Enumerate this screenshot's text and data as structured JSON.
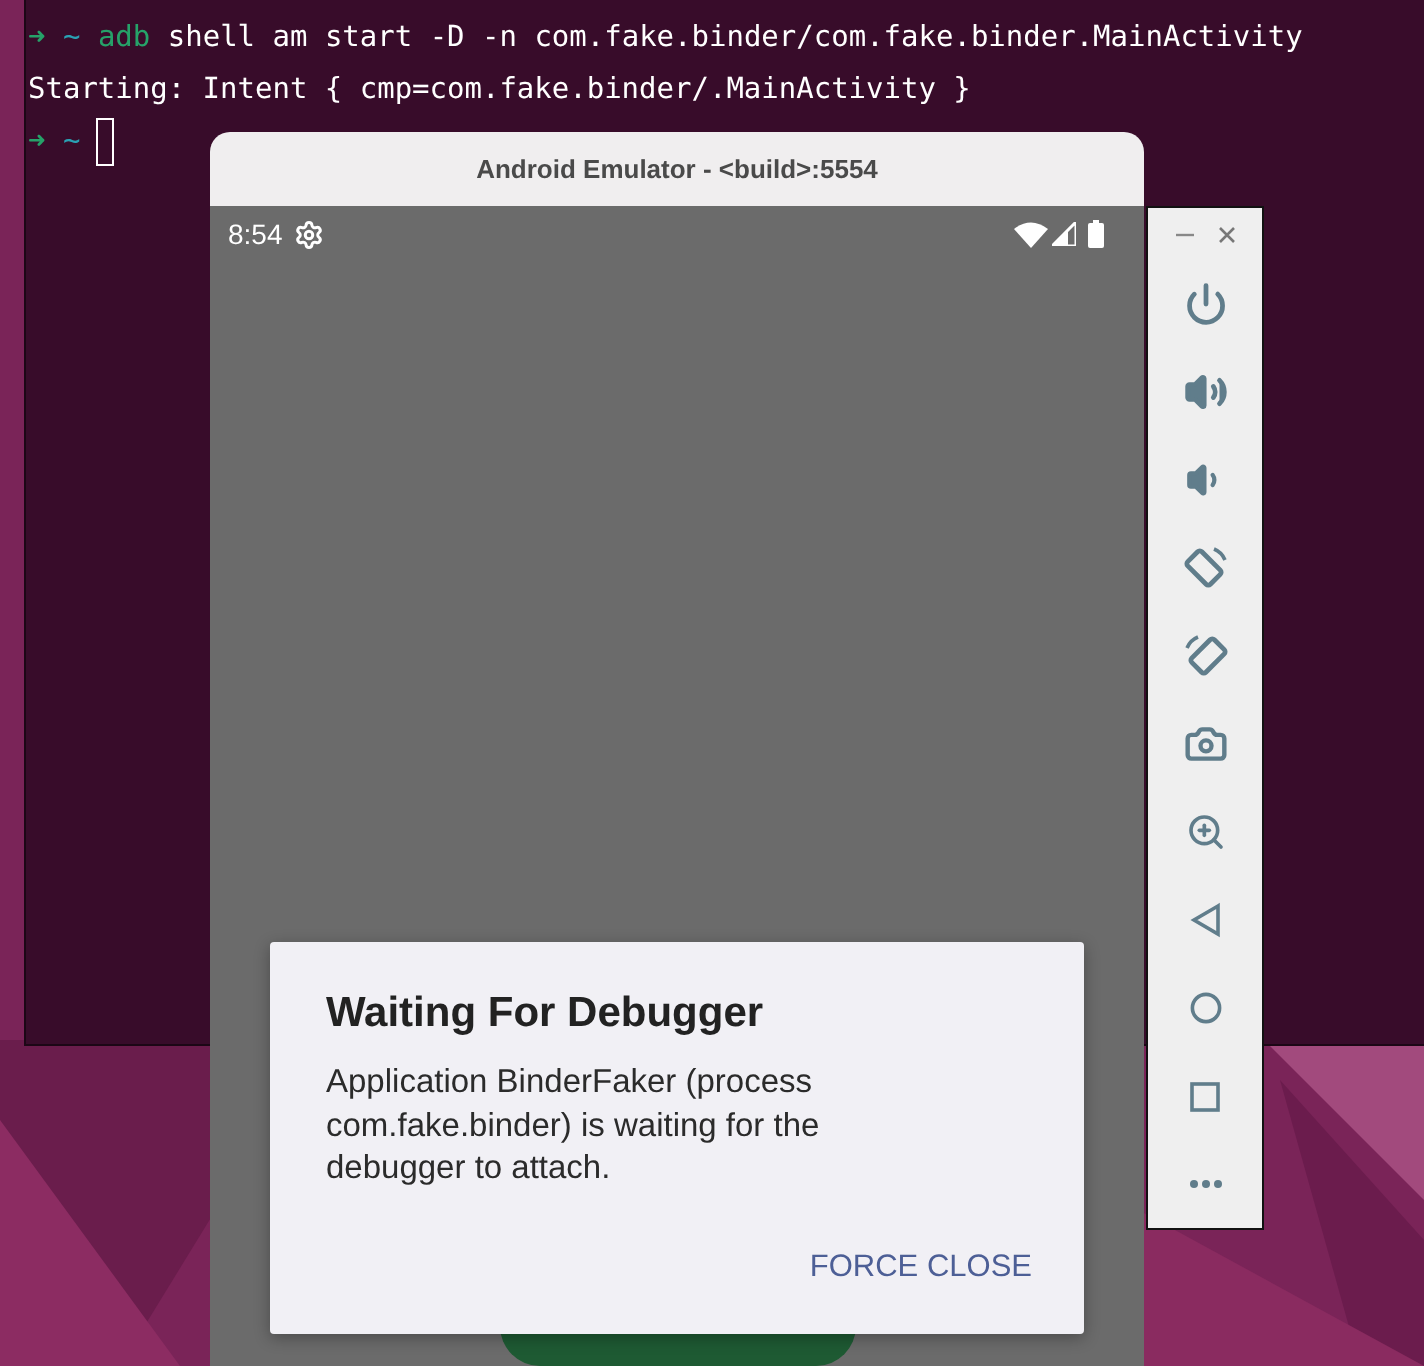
{
  "terminal": {
    "lines": [
      {
        "kind": "prompt",
        "prompt": "➜",
        "dir": "~",
        "command": "adb",
        "args": "shell am start -D -n com.fake.binder/com.fake.binder.MainActivity",
        "cursor": false
      },
      {
        "kind": "output",
        "text": "Starting: Intent { cmp=com.fake.binder/.MainActivity }"
      },
      {
        "kind": "prompt",
        "prompt": "➜",
        "dir": "~",
        "cursor": true
      }
    ]
  },
  "emulator": {
    "title": "Android Emulator - <build>:5554",
    "status_bar": {
      "time": "8:54"
    },
    "dialog": {
      "title": "Waiting For Debugger",
      "message": "Application BinderFaker (process com.fake.binder) is waiting for the debugger to attach.",
      "button": "FORCE CLOSE"
    }
  }
}
